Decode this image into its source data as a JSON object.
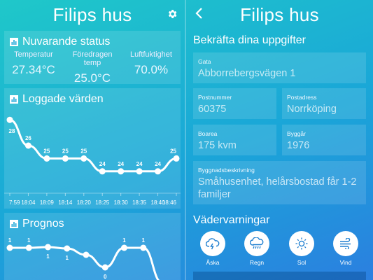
{
  "left": {
    "title": "Filips hus",
    "icons": {
      "settings": "gear-icon",
      "chart": "bar-chart-icon"
    },
    "status": {
      "heading": "Nuvarande status",
      "items": [
        {
          "label": "Temperatur",
          "value": "27.34°C"
        },
        {
          "label": "Föredragen temp",
          "value": "25.0°C"
        },
        {
          "label": "Luftfuktighet",
          "value": "70.0%"
        }
      ]
    },
    "logged": {
      "heading": "Loggade värden"
    },
    "forecast": {
      "heading": "Prognos"
    }
  },
  "chart_data": [
    {
      "type": "line",
      "title": "Loggade värden",
      "x": [
        "7:59",
        "18:04",
        "18:09",
        "18:14",
        "18:20",
        "18:25",
        "18:30",
        "18:35",
        "18:40",
        "18:46"
      ],
      "values": [
        null,
        26,
        25,
        25,
        25,
        24,
        24,
        24,
        24,
        25
      ],
      "first_point_label": "28",
      "ylim": [
        23.5,
        28.5
      ],
      "grid": false
    },
    {
      "type": "line",
      "title": "Prognos",
      "values": [
        1,
        1,
        1,
        1,
        1,
        0,
        1,
        1,
        0
      ],
      "labels_above": [
        "1",
        "1",
        "",
        "",
        "",
        "",
        "1",
        "1",
        ""
      ],
      "labels_below": [
        "",
        "",
        "1",
        "1",
        "",
        "0",
        "",
        "",
        ""
      ],
      "grid": false
    }
  ],
  "right": {
    "title": "Filips hus",
    "icons": {
      "back": "chevron-left-icon"
    },
    "confirm_heading": "Bekräfta dina uppgifter",
    "fields": {
      "gata": {
        "label": "Gata",
        "value": "Abborrebergsvägen 1"
      },
      "postnummer": {
        "label": "Postnummer",
        "value": "60375"
      },
      "postadress": {
        "label": "Postadress",
        "value": "Norrköping"
      },
      "boarea": {
        "label": "Boarea",
        "value": "175 kvm"
      },
      "byggar": {
        "label": "Byggår",
        "value": "1976"
      },
      "beskrivning": {
        "label": "Byggnadsbeskrivning",
        "value": "Småhusenhet, helårsbostad får 1-2 familjer"
      }
    },
    "warnings_heading": "Vädervarningar",
    "warnings": [
      {
        "label": "Åska",
        "icon": "thunder-cloud-icon"
      },
      {
        "label": "Regn",
        "icon": "rain-cloud-icon"
      },
      {
        "label": "Sol",
        "icon": "sun-icon"
      },
      {
        "label": "Vind",
        "icon": "wind-icon"
      }
    ],
    "colors": {
      "icon_blue": "#1e7fd0",
      "card": "rgba(255,255,255,0.12)"
    }
  }
}
